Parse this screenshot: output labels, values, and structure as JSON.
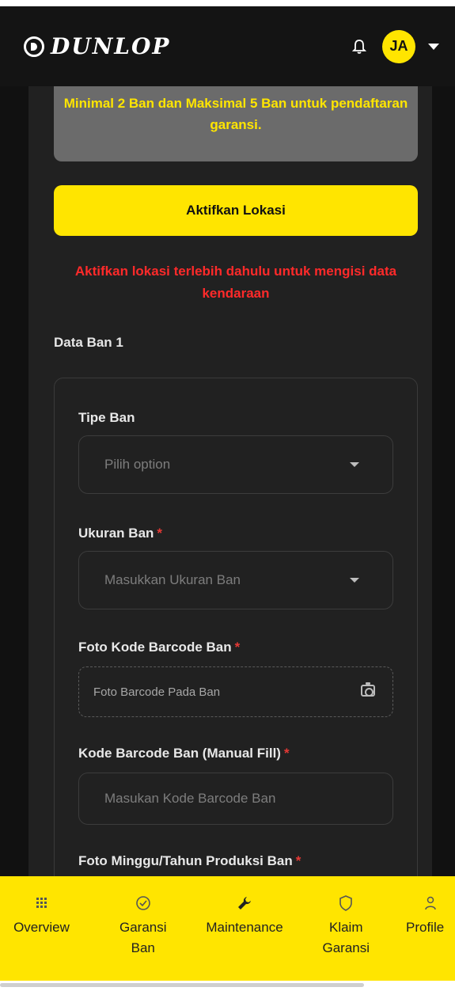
{
  "header": {
    "brand": "DUNLOP",
    "avatar_initials": "JA"
  },
  "notice": {
    "text": "Minimal 2 Ban dan Maksimal 5 Ban untuk pendaftaran garansi."
  },
  "location": {
    "button_label": "Aktifkan Lokasi",
    "warning": "Aktifkan lokasi terlebih dahulu untuk mengisi data kendaraan"
  },
  "tire_section": {
    "title": "Data Ban 1",
    "fields": {
      "tipe_ban": {
        "label": "Tipe Ban",
        "placeholder": "Pilih option"
      },
      "ukuran_ban": {
        "label": "Ukuran Ban",
        "required_mark": "*",
        "placeholder": "Masukkan Ukuran Ban"
      },
      "foto_barcode": {
        "label": "Foto Kode Barcode Ban",
        "required_mark": "*",
        "placeholder": "Foto Barcode Pada Ban"
      },
      "kode_barcode": {
        "label": "Kode Barcode Ban (Manual Fill)",
        "required_mark": "*",
        "placeholder": "Masukan Kode Barcode Ban"
      },
      "foto_minggu": {
        "label": "Foto Minggu/Tahun Produksi Ban",
        "required_mark": "*"
      }
    }
  },
  "bottom_nav": {
    "items": [
      {
        "label_line1": "Overview",
        "label_line2": "",
        "icon": "grid-icon"
      },
      {
        "label_line1": "Garansi",
        "label_line2": "Ban",
        "icon": "check-badge-icon"
      },
      {
        "label_line1": "Maintenance",
        "label_line2": "",
        "icon": "wrench-icon"
      },
      {
        "label_line1": "Klaim",
        "label_line2": "Garansi",
        "icon": "shield-icon"
      },
      {
        "label_line1": "Profile",
        "label_line2": "",
        "icon": "person-icon"
      }
    ]
  },
  "colors": {
    "accent": "#ffe500",
    "warning": "#ff2a2a",
    "panel": "#212121",
    "header": "#141414"
  }
}
